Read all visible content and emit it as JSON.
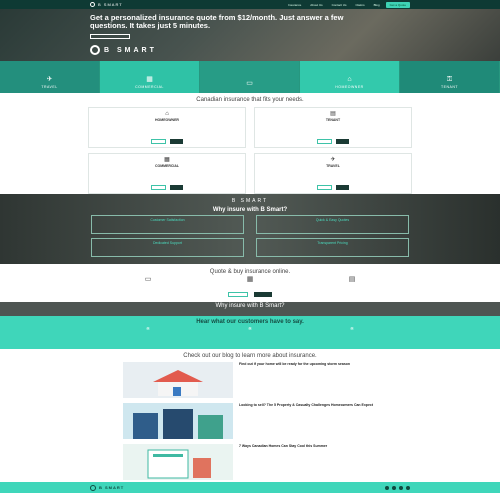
{
  "nav": {
    "brand": "B SMART",
    "items": [
      "Insurance",
      "About Us",
      "Contact Us",
      "Claims",
      "Blog"
    ],
    "cta": "Get a Quote"
  },
  "hero": {
    "headline": "Get a personalized insurance quote from $12/month. Just answer a few questions. It takes just 5 minutes.",
    "brand": "B SMART"
  },
  "tiles": [
    {
      "label": "TRAVEL",
      "icon": "airplane-icon"
    },
    {
      "label": "COMMERCIAL",
      "icon": "building-icon"
    },
    {
      "label": "",
      "icon": "car-icon"
    },
    {
      "label": "HOMEOWNER",
      "icon": "home-icon"
    },
    {
      "label": "TENANT",
      "icon": "key-icon"
    }
  ],
  "products": {
    "title": "Canadian insurance that fits your needs.",
    "cards": [
      {
        "title": "HOMEOWNER",
        "icon": "house-icon"
      },
      {
        "title": "TENANT",
        "icon": "apartment-icon"
      },
      {
        "title": "COMMERCIAL",
        "icon": "shop-icon"
      },
      {
        "title": "TRAVEL",
        "icon": "plane-icon"
      }
    ]
  },
  "why": {
    "brand": "B SMART",
    "title": "Why insure with B Smart?",
    "boxes": [
      {
        "title": "Customer Satisfaction"
      },
      {
        "title": "Quick & Easy Quotes"
      },
      {
        "title": "Dedicated Support"
      },
      {
        "title": "Transparent Pricing"
      }
    ]
  },
  "quote": {
    "title": "Quote & buy insurance online."
  },
  "why2": {
    "title": "Why insure with B Smart?"
  },
  "testimonials": {
    "title": "Hear what our customers have to say."
  },
  "blog": {
    "title": "Check out our blog to learn more about insurance.",
    "posts": [
      {
        "title": "Find out if your home will be ready for the upcoming storm season"
      },
      {
        "title": "Looking to sell? The 5 Property & Casualty Challenges Homeowners Can Expect"
      },
      {
        "title": "7 Ways Canadian Homes Can Stay Cool this Summer"
      }
    ]
  },
  "footer": {
    "brand": "B SMART"
  },
  "colors": {
    "teal": "#3fd6ba",
    "dark": "#0e3a34"
  }
}
